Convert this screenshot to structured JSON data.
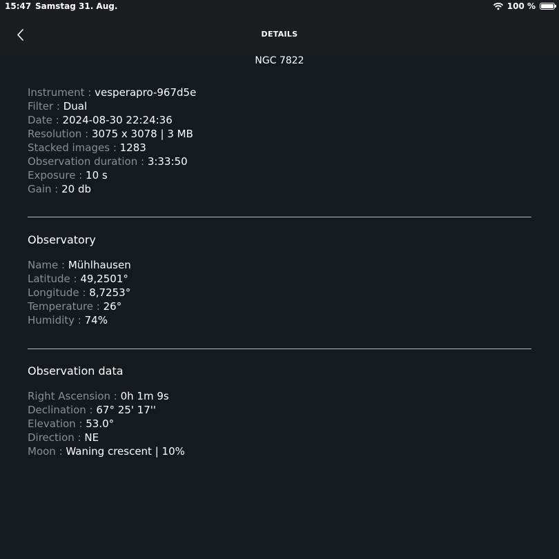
{
  "status_bar": {
    "time": "15:47",
    "date": "Samstag 31. Aug.",
    "battery_percent": "100 %",
    "icons": [
      "wifi-icon",
      "battery-icon"
    ]
  },
  "header": {
    "title": "DETAILS",
    "back_icon": "chevron-left-icon"
  },
  "object_name": "NGC 7822",
  "capture": {
    "rows": [
      {
        "label": "Instrument : ",
        "value": "vesperapro-967d5e"
      },
      {
        "label": "Filter : ",
        "value": "Dual"
      },
      {
        "label": "Date : ",
        "value": "2024-08-30 22:24:36"
      },
      {
        "label": "Resolution : ",
        "value": "3075 x 3078 | 3 MB"
      },
      {
        "label": "Stacked images : ",
        "value": "1283"
      },
      {
        "label": "Observation duration : ",
        "value": "3:33:50"
      },
      {
        "label": "Exposure : ",
        "value": "10 s"
      },
      {
        "label": "Gain : ",
        "value": "20 db"
      }
    ]
  },
  "observatory": {
    "heading": "Observatory",
    "rows": [
      {
        "label": "Name : ",
        "value": "Mühlhausen"
      },
      {
        "label": "Latitude : ",
        "value": "49,2501°"
      },
      {
        "label": "Longitude : ",
        "value": "8,7253°"
      },
      {
        "label": "Temperature : ",
        "value": "26°"
      },
      {
        "label": "Humidity : ",
        "value": "74%"
      }
    ]
  },
  "observation_data": {
    "heading": "Observation data",
    "rows": [
      {
        "label": "Right Ascension : ",
        "value": "0h 1m 9s"
      },
      {
        "label": "Declination : ",
        "value": "67° 25' 17''"
      },
      {
        "label": "Elevation : ",
        "value": "53.0°"
      },
      {
        "label": "Direction : ",
        "value": "NE"
      },
      {
        "label": "Moon : ",
        "value": "Waning crescent | 10%"
      }
    ]
  },
  "colors": {
    "background": "#151a21",
    "header_background": "#1c1d20",
    "label": "#8a8f97",
    "value": "#ffffff",
    "divider": "#b9bcc0"
  }
}
